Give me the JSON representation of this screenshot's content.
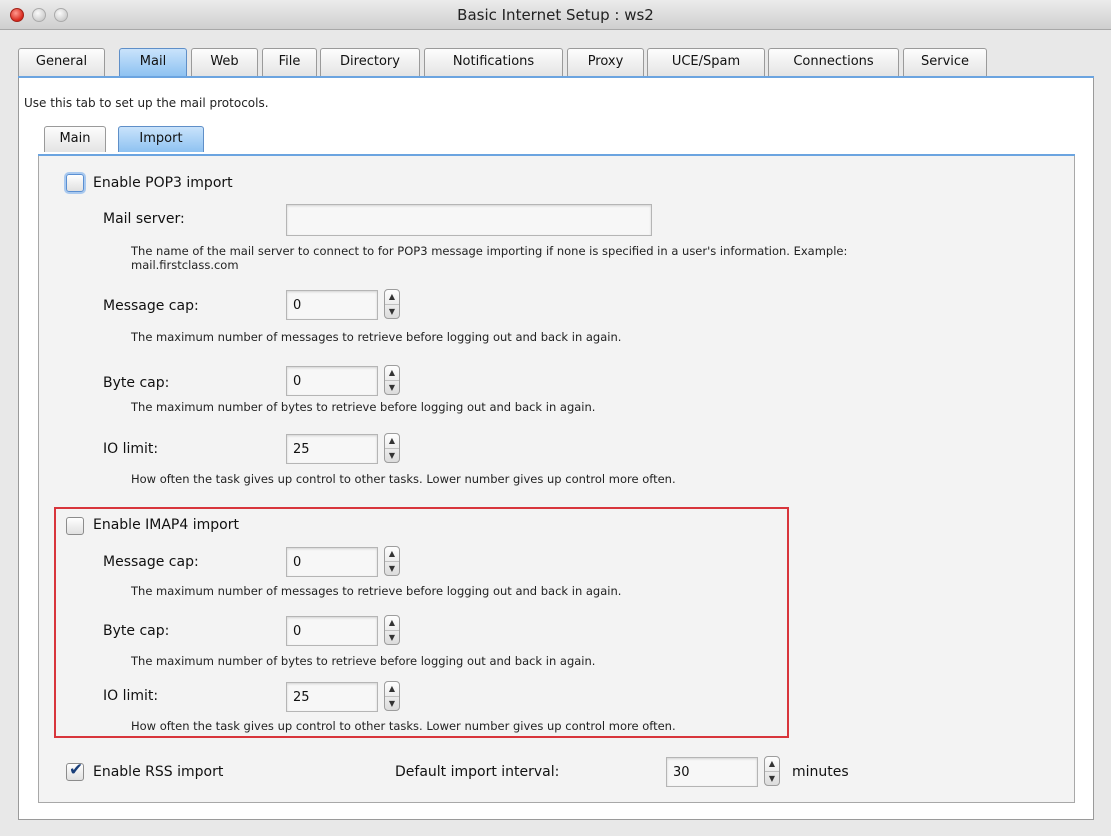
{
  "window": {
    "title": "Basic Internet Setup : ws2"
  },
  "top_tabs": [
    "General",
    "Mail",
    "Web",
    "File",
    "Directory",
    "Notifications",
    "Proxy",
    "UCE/Spam",
    "Connections",
    "Service"
  ],
  "active_top_tab": "Mail",
  "intro_text": "Use this tab to set up the mail protocols.",
  "sub_tabs": [
    "Main",
    "Import"
  ],
  "active_sub_tab": "Import",
  "pop3": {
    "enable_label": "Enable POP3 import",
    "enabled": false,
    "mail_server_label": "Mail server:",
    "mail_server_value": "",
    "mail_server_help": "The name of the mail server to connect to for POP3 message importing if none is specified in a user's information. Example:",
    "mail_server_help_2": "mail.firstclass.com",
    "message_cap_label": "Message cap:",
    "message_cap_value": "0",
    "message_cap_help": "The maximum number of messages to retrieve before logging out and back in again.",
    "byte_cap_label": "Byte cap:",
    "byte_cap_value": "0",
    "byte_cap_help": "The maximum number of bytes to retrieve before logging out and back in again.",
    "io_limit_label": "IO limit:",
    "io_limit_value": "25",
    "io_limit_help": "How often the task gives up control to other tasks. Lower number gives up control more often."
  },
  "imap4": {
    "enable_label": "Enable IMAP4 import",
    "enabled": false,
    "message_cap_label": "Message cap:",
    "message_cap_value": "0",
    "message_cap_help": "The maximum number of messages to retrieve before logging out and back in again.",
    "byte_cap_label": "Byte cap:",
    "byte_cap_value": "0",
    "byte_cap_help": "The maximum number of bytes to retrieve before logging out and back in again.",
    "io_limit_label": "IO limit:",
    "io_limit_value": "25",
    "io_limit_help": "How often the task gives up control to other tasks. Lower number gives up control more often."
  },
  "rss": {
    "enable_label": "Enable RSS import",
    "enabled": true,
    "interval_label": "Default import interval:",
    "interval_value": "30",
    "interval_unit": "minutes"
  },
  "colors": {
    "accent": "#6ba4e0",
    "active_tab": "#8ec2f1",
    "highlight_box": "#d8353b"
  }
}
